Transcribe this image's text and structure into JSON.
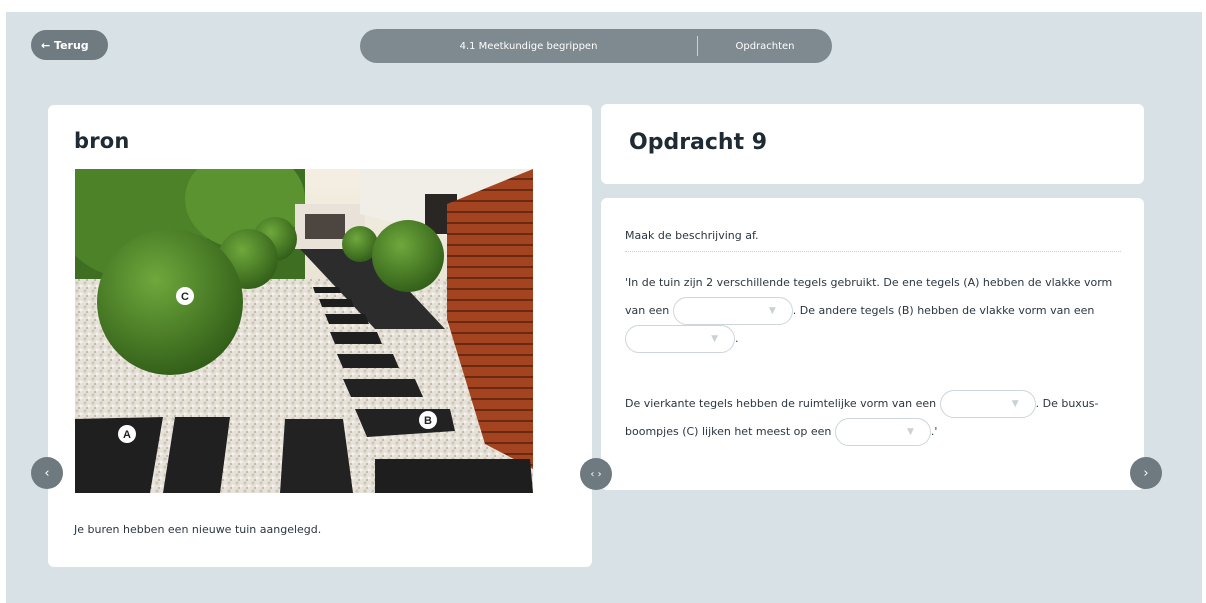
{
  "header": {
    "back_label": "← Terug",
    "crumb_section": "4.1 Meetkundige begrippen",
    "crumb_page": "Opdrachten"
  },
  "source": {
    "heading": "bron",
    "caption": "Je buren hebben een nieuwe tuin aangelegd.",
    "labels": {
      "a": "A",
      "b": "B",
      "c": "C"
    }
  },
  "task": {
    "title": "Opdracht 9",
    "instruction": "Maak de beschrijving af.",
    "p1": {
      "t1": "'In de tuin zijn 2 verschillende tegels gebruikt. De ene tegels (A) hebben de vlakke vorm van een",
      "t2": ". De andere tegels (B) hebben de vlakke vorm van een",
      "t3": "."
    },
    "p2": {
      "t1": "De vierkante tegels hebben de ruimtelijke vorm van een",
      "t2": ". De buxus-boompjes (C) lijken het meest op een",
      "t3": ".'"
    }
  },
  "nav": {
    "prev": "‹",
    "mid": "‹ ›",
    "next": "›"
  },
  "colors": {
    "background": "#d7e1e6",
    "nav": "#6e7a80",
    "heading": "#1e2a34"
  },
  "icons": [
    "arrow-left-icon",
    "chevron-down-icon",
    "chevron-left-icon",
    "chevron-right-icon"
  ]
}
